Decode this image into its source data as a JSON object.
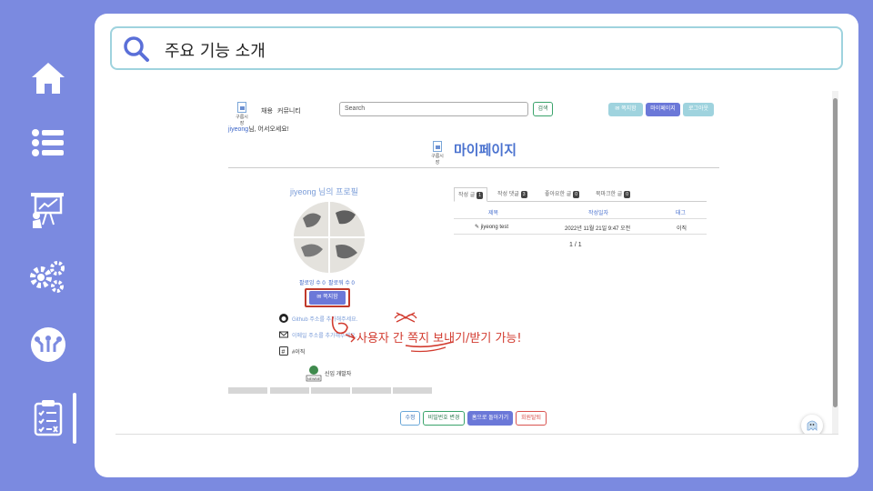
{
  "slide": {
    "search_text": "주요 기능 소개",
    "annotation_text": "사용자 간 쪽지 보내기/받기 가능!"
  },
  "rail": {
    "icons": [
      "home-icon",
      "list-icon",
      "presentation-icon",
      "gears-icon",
      "circuit-bulb-icon",
      "clipboard-checklist-icon"
    ],
    "accent": "#7b8ae0"
  },
  "site": {
    "logo_text": "구름시장",
    "nav": [
      "채용",
      "커뮤니티"
    ],
    "search_placeholder": "Search",
    "search_button": "검색",
    "top_buttons": [
      "쪽지함",
      "마이페이지",
      "로그아웃"
    ],
    "welcome_user": "jiyeong",
    "welcome_suffix": "님, 어서오세요!",
    "page_title": "마이페이지"
  },
  "profile": {
    "title": "jiyeong 님의 프로필",
    "following": "팔로잉 수 0",
    "followers": "팔로워 수 0",
    "message_button": "쪽지함",
    "github": "Github 주소를 추가해주세요.",
    "email": "이메일 주소를 추가해주세요.",
    "tag": "#이직",
    "badge_label": "신입 개발자",
    "badge_icon_text": "NEWBIE"
  },
  "tabs": [
    {
      "label": "작성 글",
      "count": "1"
    },
    {
      "label": "작성 댓글",
      "count": "3"
    },
    {
      "label": "좋아요한 글",
      "count": "0"
    },
    {
      "label": "북마크한 글",
      "count": "0"
    }
  ],
  "table": {
    "headers": [
      "제목",
      "작성일자",
      "태그"
    ],
    "rows": [
      {
        "title": "jiyeong test",
        "date": "2022년 11월 21일 9:47 오전",
        "tag": "이직"
      }
    ],
    "pager": "1 / 1"
  },
  "bottom_buttons": [
    "수정",
    "비밀번호 변경",
    "홈으로 돌아가기",
    "회원탈퇴"
  ]
}
